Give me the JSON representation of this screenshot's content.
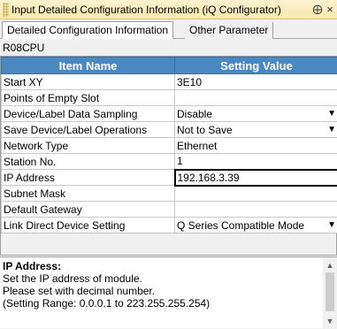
{
  "titlebar": {
    "title": "Input Detailed Configuration Information (iQ Configurator)",
    "pin_glyph": "⨁",
    "close_glyph": "×"
  },
  "tabs": [
    "Detailed Configuration Information",
    "Other Parameter"
  ],
  "cpu": "R08CPU",
  "grid": {
    "headers": [
      "Item Name",
      "Setting Value"
    ],
    "rows": [
      {
        "name": "Start XY",
        "value": "3E10",
        "dropdown": false
      },
      {
        "name": "Points of Empty Slot",
        "value": "",
        "dropdown": false
      },
      {
        "name": "Device/Label Data Sampling",
        "value": "Disable",
        "dropdown": true
      },
      {
        "name": "Save Device/Label Operations",
        "value": "Not to Save",
        "dropdown": true
      },
      {
        "name": "Network Type",
        "value": "Ethernet",
        "dropdown": false
      },
      {
        "name": "Station No.",
        "value": "1",
        "dropdown": false
      },
      {
        "name": "IP Address",
        "value": "192.168.3.39",
        "dropdown": false,
        "selected": true
      },
      {
        "name": "Subnet Mask",
        "value": "",
        "dropdown": false
      },
      {
        "name": "Default Gateway",
        "value": "",
        "dropdown": false
      },
      {
        "name": "Link Direct Device Setting",
        "value": "Q Series Compatible Mode",
        "dropdown": true
      }
    ]
  },
  "description": {
    "title": "IP Address:",
    "lines": [
      "Set the IP address of module.",
      "Please set with decimal number.",
      "(Setting Range: 0.0.0.1 to 223.255.255.254)"
    ]
  },
  "colors": {
    "header_bg": "#4a88c2",
    "titlebar_bg": "#f9e8b0"
  }
}
